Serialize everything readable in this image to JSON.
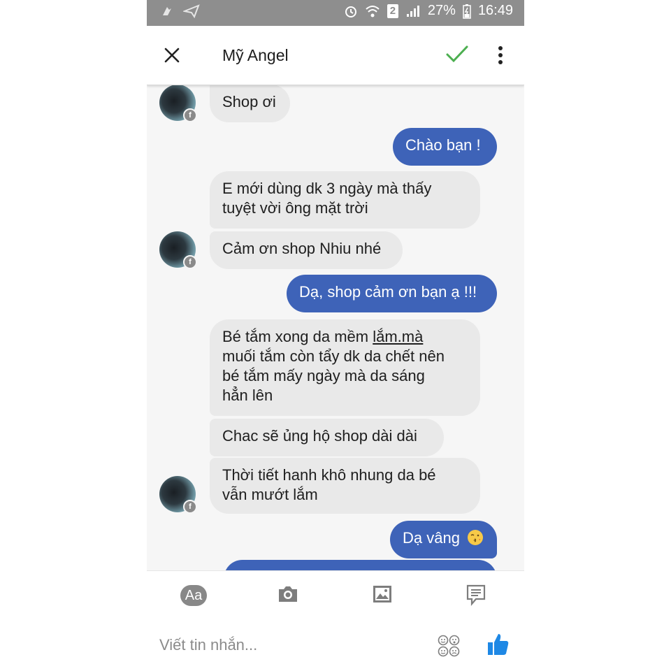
{
  "status_bar": {
    "battery": "27%",
    "time": "16:49",
    "sim_slot": "2"
  },
  "header": {
    "title": "Mỹ Angel"
  },
  "messages": [
    {
      "dir": "in",
      "text": "Shop ơi"
    },
    {
      "dir": "out",
      "text": "Chào bạn !"
    },
    {
      "dir": "in",
      "lines": [
        "E mới dùng dk 3 ngày mà thấy",
        "tuyệt vời ông mặt trời"
      ]
    },
    {
      "dir": "in",
      "text": "Cảm ơn shop Nhiu nhé"
    },
    {
      "dir": "out",
      "text": "Dạ, shop cảm ơn bạn ạ !!!"
    },
    {
      "dir": "in",
      "lines": [
        "Bé tắm xong da mềm lắm.mà",
        "muối tắm còn tẩy dk da chết nên",
        "bé tắm mấy ngày mà da sáng",
        "hẳn lên"
      ]
    },
    {
      "dir": "in",
      "text": "Chac sẽ ủng hộ shop dài dài"
    },
    {
      "dir": "in",
      "lines": [
        "Thời tiết hanh khô nhung da bé",
        "vẫn mướt lắm"
      ]
    },
    {
      "dir": "out",
      "text": "Dạ vâng"
    }
  ],
  "msg6_parts": {
    "pre": "Bé tắm xong da mềm ",
    "underlined": "lắm.mà"
  },
  "composer": {
    "text_button_label": "Aa",
    "placeholder": "Viết tin nhắn..."
  },
  "colors": {
    "outgoing_bubble": "#3e63b8",
    "incoming_bubble": "#e9e9e9",
    "accent_check": "#4caf50",
    "like_thumb": "#1e88e5",
    "status_bar": "#8e8e8e"
  },
  "icons": [
    "close-icon",
    "check-icon",
    "more-vert-icon",
    "camera-icon",
    "image-icon",
    "sticker-icon",
    "emoji-icon",
    "like-icon",
    "alarm-icon",
    "wifi-icon",
    "signal-icon",
    "battery-icon"
  ]
}
